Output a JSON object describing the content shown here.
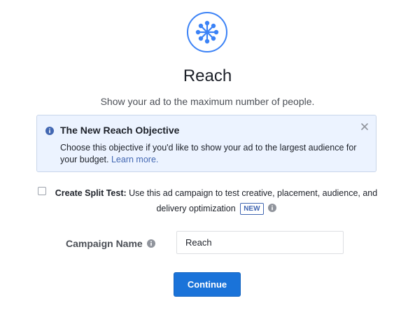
{
  "objective": {
    "icon": "reach-network-icon",
    "title": "Reach",
    "subtitle": "Show your ad to the maximum number of people."
  },
  "info_box": {
    "icon": "info-icon",
    "title": "The New Reach Objective",
    "body": "Choose this objective if you'd like to show your ad to the largest audience for your budget.",
    "link": "Learn more.",
    "close_icon": "close-icon"
  },
  "split_test": {
    "checked": false,
    "label": "Create Split Test:",
    "description": "Use this ad campaign to test creative, placement, audience, and delivery optimization",
    "badge": "NEW",
    "help_icon": "info-icon"
  },
  "campaign": {
    "label": "Campaign Name",
    "value": "Reach",
    "help_icon": "info-icon"
  },
  "continue_label": "Continue",
  "colors": {
    "accent": "#1a73d9",
    "icon_blue": "#3b82f6",
    "info_bg": "#ecf3ff",
    "link": "#4267b2"
  }
}
